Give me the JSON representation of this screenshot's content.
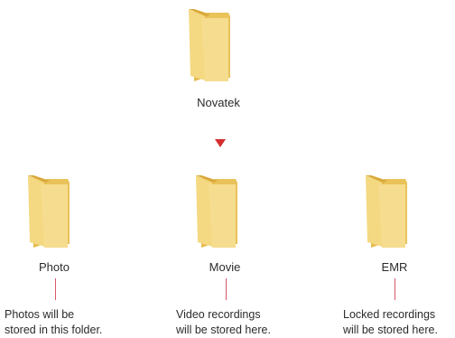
{
  "colors": {
    "folder_front": "#f4d982",
    "folder_back": "#e7bc4f",
    "folder_edge": "#d9a93b",
    "arrow": "#d32f2f",
    "connector": "#d9566a"
  },
  "root": {
    "label": "Novatek",
    "icon": "folder-icon"
  },
  "children": [
    {
      "label": "Photo",
      "icon": "folder-icon",
      "note_lines": [
        "Photos will be",
        "stored in this folder."
      ]
    },
    {
      "label": "Movie",
      "icon": "folder-icon",
      "note_lines": [
        "Video recordings",
        "will be stored here."
      ]
    },
    {
      "label": "EMR",
      "icon": "folder-icon",
      "note_lines": [
        "Locked recordings",
        "will be stored here."
      ]
    }
  ]
}
